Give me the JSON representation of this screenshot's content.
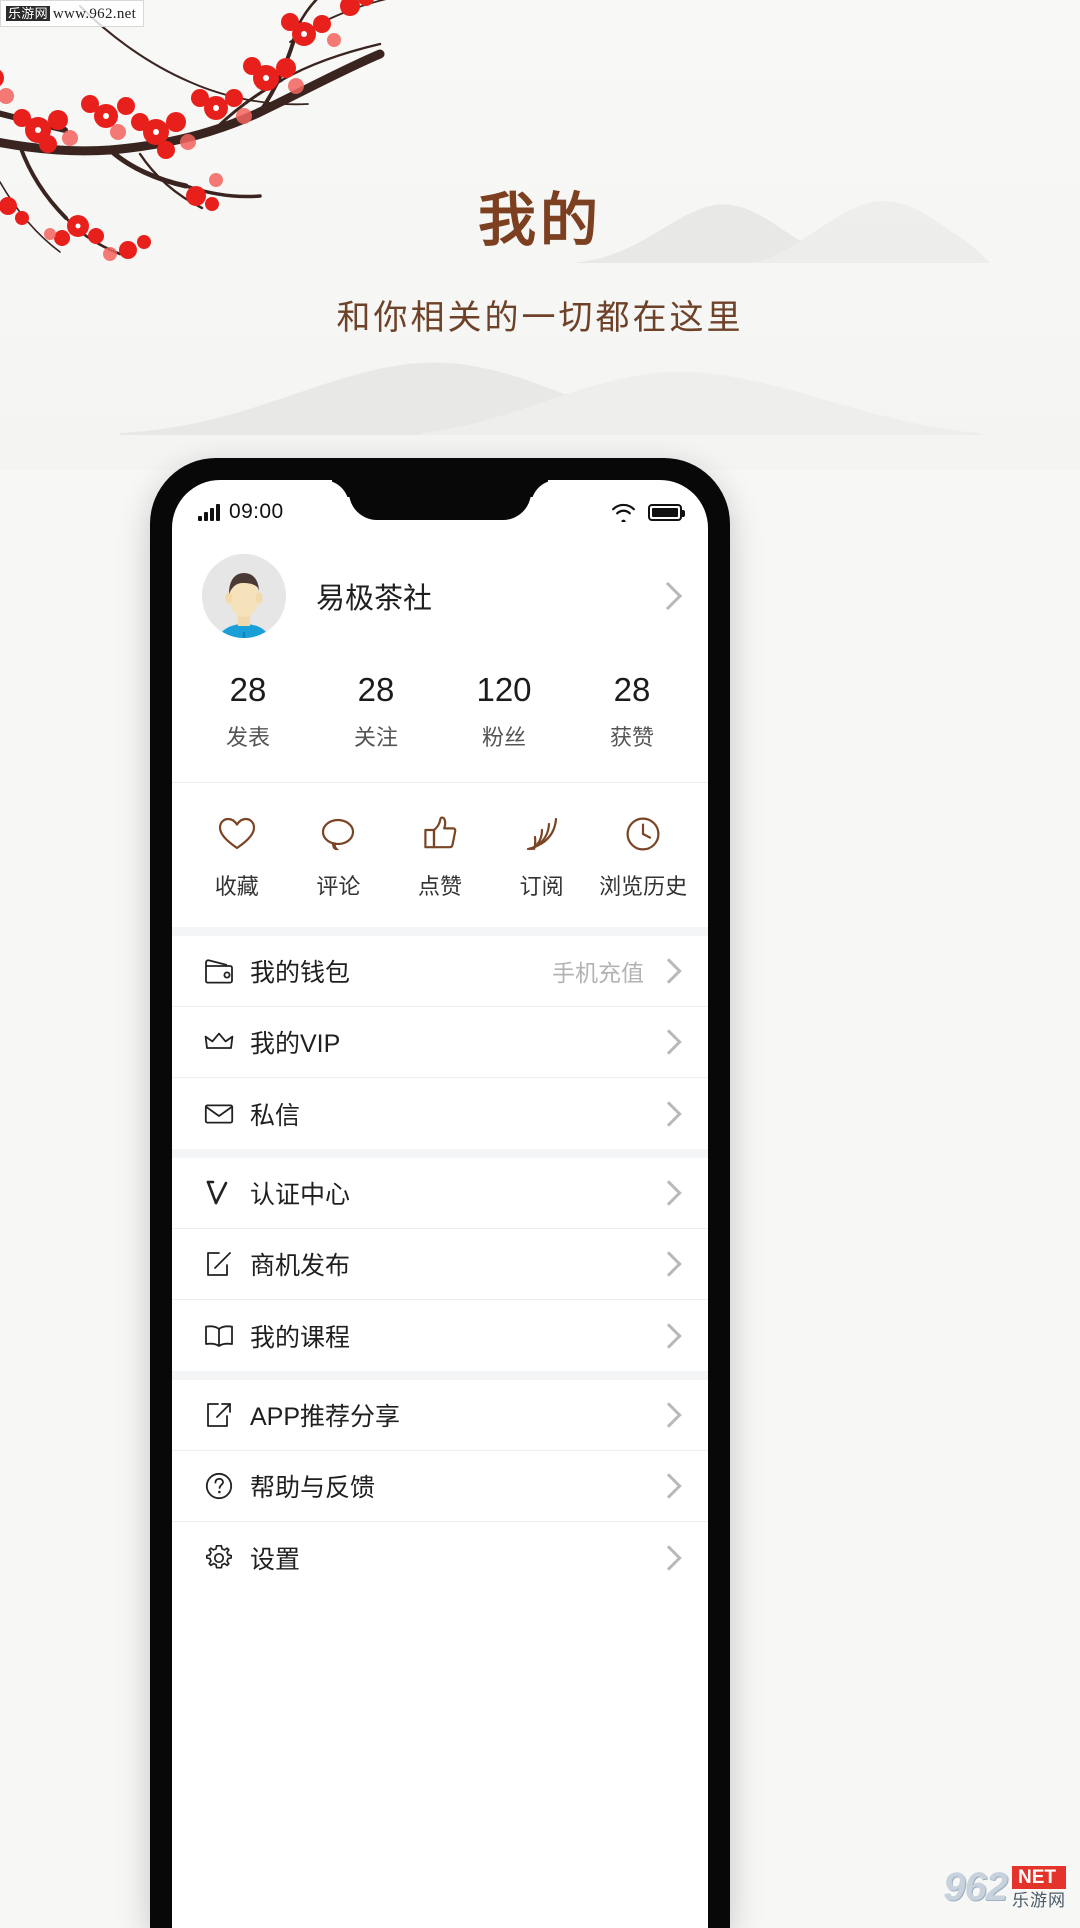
{
  "promo": {
    "title": "我的",
    "subtitle": "和你相关的一切都在这里",
    "title_color": "#7c3f20",
    "subtitle_color": "#6e4228",
    "background_color": "#f7f7f5",
    "artwork": "plum-blossom-branch-ink-painting"
  },
  "watermark_top": {
    "cn": "乐游网",
    "url": "www.962.net"
  },
  "watermark_bottom": {
    "number": "962",
    "net": "NET",
    "cn": "乐游网"
  },
  "statusbar": {
    "time": "09:00",
    "signal_icon": "signal-bars-icon",
    "wifi_icon": "wifi-icon",
    "battery_icon": "battery-full-icon"
  },
  "profile": {
    "name": "易极茶社",
    "avatar_icon": "user-avatar",
    "chevron_icon": "chevron-right-icon"
  },
  "stats": [
    {
      "value": "28",
      "label": "发表"
    },
    {
      "value": "28",
      "label": "关注"
    },
    {
      "value": "120",
      "label": "粉丝"
    },
    {
      "value": "28",
      "label": "获赞"
    }
  ],
  "quick_actions": [
    {
      "label": "收藏",
      "icon": "heart-icon"
    },
    {
      "label": "评论",
      "icon": "comment-bubble-icon"
    },
    {
      "label": "点赞",
      "icon": "thumbs-up-icon"
    },
    {
      "label": "订阅",
      "icon": "rss-icon"
    },
    {
      "label": "浏览历史",
      "icon": "clock-history-icon"
    }
  ],
  "accent_color": "#7a4524",
  "menu_groups": [
    {
      "items": [
        {
          "label": "我的钱包",
          "icon": "wallet-icon",
          "value": "手机充值"
        },
        {
          "label": "我的VIP",
          "icon": "crown-icon",
          "value": ""
        },
        {
          "label": "私信",
          "icon": "envelope-icon",
          "value": ""
        }
      ]
    },
    {
      "items": [
        {
          "label": "认证中心",
          "icon": "verify-check-icon",
          "value": ""
        },
        {
          "label": "商机发布",
          "icon": "edit-square-icon",
          "value": ""
        },
        {
          "label": "我的课程",
          "icon": "book-open-icon",
          "value": ""
        }
      ]
    },
    {
      "items": [
        {
          "label": "APP推荐分享",
          "icon": "share-arrow-icon",
          "value": ""
        },
        {
          "label": "帮助与反馈",
          "icon": "question-circle-icon",
          "value": ""
        },
        {
          "label": "设置",
          "icon": "gear-icon",
          "value": ""
        }
      ]
    }
  ]
}
